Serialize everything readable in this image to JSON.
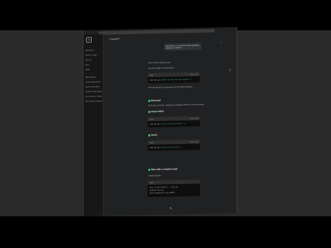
{
  "window": {
    "title": "ChatGPT"
  },
  "sidebar": {
    "items": [
      "New chat",
      "Search chats",
      "Library",
      "Sora",
      "GPTs",
      "",
      "New project",
      "Code explanation",
      "Linux SSH setup",
      "Guide: Flask deployment",
      "Local server config",
      "Run Python tutorial"
    ]
  },
  "chat": {
    "user_message": "bash/bin/sh: 1: not found when installing package on Ubuntu",
    "intro": "Here's the fix step by step:",
    "step_label": "Run the update command first:",
    "code_blocks": [
      {
        "lang": "bash",
        "copy": "Copy code",
        "line_pre": "sudo apt-get ",
        "line_hi": "update && sudo apt-get upgrade -y"
      },
      {
        "lang": "bash",
        "copy": "Copy code",
        "line_pre": "sudo apt-get ",
        "line_hi": "install build-essential -y"
      },
      {
        "lang": "bash",
        "copy": "Copy code",
        "line_pre": "sudo apt-get ",
        "line_hi": "install python3-pip -y"
      }
    ],
    "note": "This will refresh your package list and install updates.",
    "section_a": "Reinstall",
    "section_a_text": "If the issue persists, reinstall the package with the command below:",
    "section_b": "Check PATH",
    "section_c": "Verify",
    "section_d": "Test with a simple script",
    "section_d_text": "Create test file:",
    "bottom_code": {
      "lang": "bash",
      "line1": "echo 'print(\"hello\")' > test.py",
      "line2": "python3 test.py",
      "line3": "which python3 && echo $PATH"
    }
  }
}
